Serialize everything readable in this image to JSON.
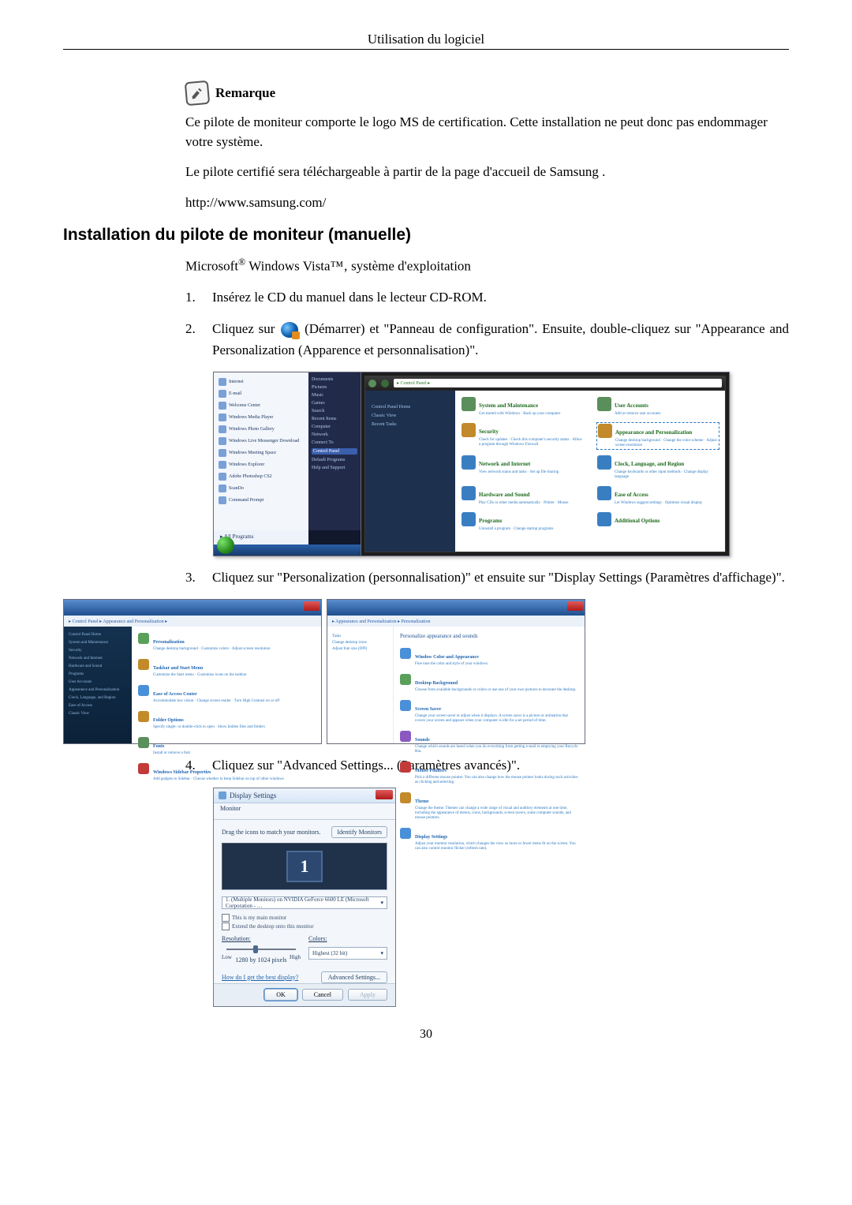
{
  "header": "Utilisation du logiciel",
  "remarque_label": "Remarque",
  "para1": "Ce pilote de moniteur comporte le logo MS de certification. Cette installation ne peut donc pas endommager votre système.",
  "para2": "Le pilote certifié sera téléchargeable à partir de la page d'accueil de Samsung .",
  "para3": "http://www.samsung.com/",
  "section_title": "Installation du pilote de moniteur (manuelle)",
  "os_line_prefix": "Microsoft",
  "os_line_middle": " Windows Vista™‚ système d'exploitation",
  "steps": {
    "s1": {
      "num": "1.",
      "text": "Insérez le CD du manuel dans le lecteur CD-ROM."
    },
    "s2": {
      "num": "2.",
      "pre": "Cliquez sur",
      "post": "(Démarrer) et \"Panneau de configuration\". Ensuite, double-cliquez sur \"Appearance and Personalization (Apparence et personnalisation)\"."
    },
    "s3": {
      "num": "3.",
      "text": "Cliquez sur \"Personalization (personnalisation)\" et ensuite sur \"Display Settings (Paramètres d'affichage)\"."
    },
    "s4": {
      "num": "4.",
      "text": "Cliquez sur \"Advanced Settings... (Paramètres avancés)\"."
    }
  },
  "start_menu": {
    "items": [
      "Internet",
      "E-mail",
      "Welcome Center",
      "Windows Media Player",
      "Windows Photo Gallery",
      "Windows Live Messenger Download",
      "Windows Meeting Space",
      "Windows Explorer",
      "Adobe Photoshop CS2",
      "ScanDo",
      "Command Prompt"
    ],
    "all_programs": "All Programs",
    "right": [
      "Documents",
      "Pictures",
      "Music",
      "Games",
      "Search",
      "Recent Items",
      "Computer",
      "Network",
      "Connect To",
      "Control Panel",
      "Default Programs",
      "Help and Support"
    ]
  },
  "control_panel": {
    "breadcrumb": "▸ Control Panel ▸",
    "side": [
      "Control Panel Home",
      "Classic View",
      "Recent Tasks"
    ],
    "cats": [
      {
        "title": "System and Maintenance",
        "sub": "Get started with Windows · Back up your computer",
        "color": "#3a7e3a"
      },
      {
        "title": "User Accounts",
        "sub": "Add or remove user accounts",
        "color": "#3a7e3a"
      },
      {
        "title": "Security",
        "sub": "Check for updates · Check this computer's security status · Allow a program through Windows Firewall",
        "color": "#3a7e3a"
      },
      {
        "title": "Appearance and Personalization",
        "sub": "Change desktop background · Change the color scheme · Adjust screen resolution",
        "color": "#3a7e3a"
      },
      {
        "title": "Network and Internet",
        "sub": "View network status and tasks · Set up file sharing",
        "color": "#3a7e3a"
      },
      {
        "title": "Clock, Language, and Region",
        "sub": "Change keyboards or other input methods · Change display language",
        "color": "#3a7e3a"
      },
      {
        "title": "Hardware and Sound",
        "sub": "Play CDs or other media automatically · Printer · Mouse",
        "color": "#3a7e3a"
      },
      {
        "title": "Ease of Access",
        "sub": "Let Windows suggest settings · Optimize visual display",
        "color": "#3a7e3a"
      },
      {
        "title": "Programs",
        "sub": "Uninstall a program · Change startup programs",
        "color": "#3a7e3a"
      },
      {
        "title": "Additional Options",
        "sub": "",
        "color": "#3a7e3a"
      }
    ]
  },
  "pers_left": {
    "addr": "▸ Control Panel ▸ Appearance and Personalization ▸",
    "side": [
      "Control Panel Home",
      "System and Maintenance",
      "Security",
      "Network and Internet",
      "Hardware and Sound",
      "Programs",
      "User Accounts",
      "Appearance and Personalization",
      "Clock, Language, and Region",
      "Ease of Access",
      "Classic View"
    ],
    "items": [
      {
        "t": "Personalization",
        "s": "Change desktop background · Customize colors · Adjust screen resolution"
      },
      {
        "t": "Taskbar and Start Menu",
        "s": "Customize the Start menu · Customize icons on the taskbar"
      },
      {
        "t": "Ease of Access Center",
        "s": "Accommodate low vision · Change screen reader · Turn High Contrast on or off"
      },
      {
        "t": "Folder Options",
        "s": "Specify single- or double-click to open · Show hidden files and folders"
      },
      {
        "t": "Fonts",
        "s": "Install or remove a font"
      },
      {
        "t": "Windows Sidebar Properties",
        "s": "Add gadgets to Sidebar · Choose whether to keep Sidebar on top of other windows"
      }
    ]
  },
  "pers_right": {
    "addr": "▸ Appearance and Personalization ▸ Personalization",
    "side": [
      "Tasks",
      "Change desktop icons",
      "Adjust font size (DPI)"
    ],
    "heading": "Personalize appearance and sounds",
    "items": [
      {
        "t": "Window Color and Appearance",
        "s": "Fine tune the color and style of your windows."
      },
      {
        "t": "Desktop Background",
        "s": "Choose from available backgrounds or colors or use one of your own pictures to decorate the desktop."
      },
      {
        "t": "Screen Saver",
        "s": "Change your screen saver or adjust when it displays. A screen saver is a picture or animation that covers your screen and appears when your computer is idle for a set period of time."
      },
      {
        "t": "Sounds",
        "s": "Change which sounds are heard when you do everything from getting e-mail to emptying your Recycle Bin."
      },
      {
        "t": "Mouse Pointers",
        "s": "Pick a different mouse pointer. You can also change how the mouse pointer looks during such activities as clicking and selecting."
      },
      {
        "t": "Theme",
        "s": "Change the theme. Themes can change a wide range of visual and auditory elements at one time, including the appearance of menus, icons, backgrounds, screen savers, some computer sounds, and mouse pointers."
      },
      {
        "t": "Display Settings",
        "s": "Adjust your monitor resolution, which changes the view so more or fewer items fit on the screen. You can also control monitor flicker (refresh rate)."
      }
    ]
  },
  "display_settings": {
    "title": "Display Settings",
    "tab": "Monitor",
    "drag": "Drag the icons to match your monitors.",
    "identify": "Identify Monitors",
    "monitor_num": "1",
    "select": "1. (Multiple Monitors) on NVIDIA GeForce 6600 LE (Microsoft Corporation - …",
    "chk1": "This is my main monitor",
    "chk2": "Extend the desktop onto this monitor",
    "res_label": "Resolution:",
    "low": "Low",
    "high": "High",
    "res_value": "1280 by 1024 pixels",
    "colors_label": "Colors:",
    "colors_value": "Highest (32 bit)",
    "help_link": "How do I get the best display?",
    "adv": "Advanced Settings...",
    "ok": "OK",
    "cancel": "Cancel",
    "apply": "Apply"
  },
  "page_number": "30"
}
